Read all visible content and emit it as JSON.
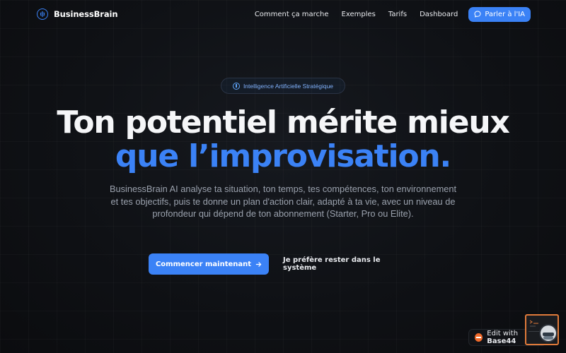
{
  "nav": {
    "brand": "BusinessBrain",
    "links": [
      "Comment ça marche",
      "Exemples",
      "Tarifs",
      "Dashboard"
    ],
    "cta_label": "Parler à l'IA"
  },
  "hero": {
    "badge": "Intelligence Artificielle Stratégique",
    "headline_line1": "Ton potentiel mérite mieux",
    "headline_line2": "que l’improvisation.",
    "lead": "BusinessBrain AI analyse ta situation, ton temps, tes compétences, ton environnement et tes objectifs, puis te donne un plan d'action clair, adapté à ta vie, avec un niveau de profondeur qui dépend de ton abonnement (Starter, Pro ou Elite).",
    "primary_cta": "Commencer maintenant",
    "secondary_cta": "Je préfère rester dans le système"
  },
  "edit_badge": {
    "prefix": "Edit with",
    "brand": "Base44"
  },
  "colors": {
    "accent": "#3b82f6",
    "background": "#0f1115",
    "edit_brand": "#f06a2a",
    "widget_frame": "#e07a3a"
  },
  "icons": {
    "brand": "brain-icon",
    "nav_cta": "chat-bubble-icon",
    "badge": "info-circle-icon",
    "primary_cta": "arrow-right-icon"
  }
}
